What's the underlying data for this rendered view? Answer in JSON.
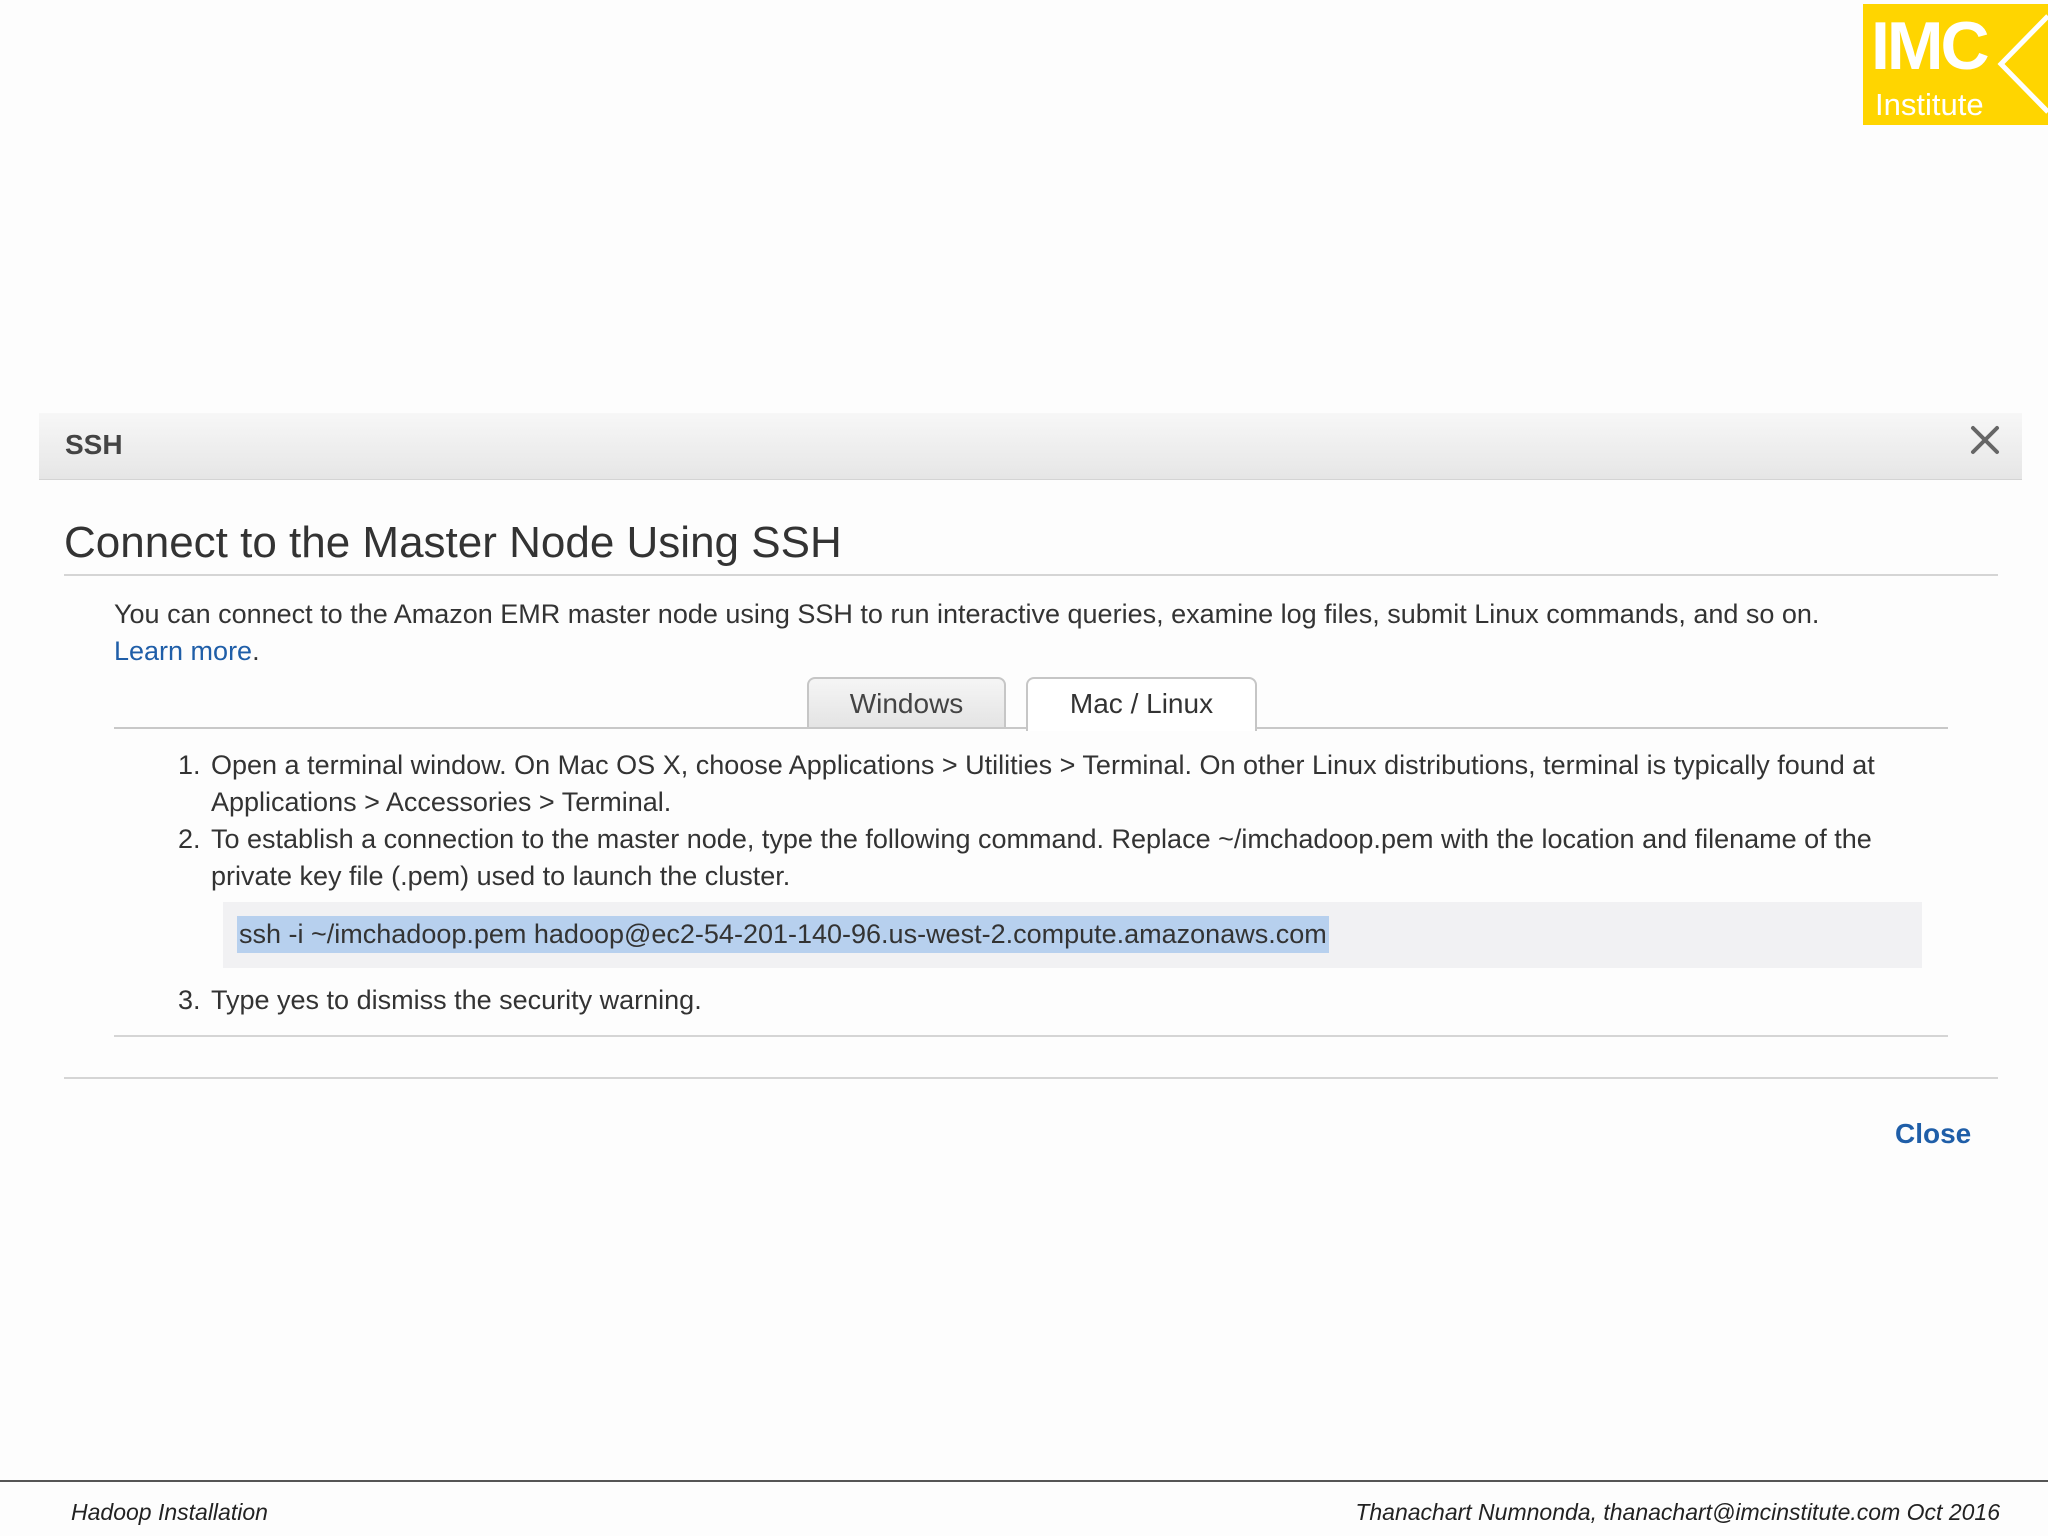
{
  "logo": {
    "word": "IMC",
    "sub": "Institute",
    "color": "#ffd500"
  },
  "dialog": {
    "header_title": "SSH",
    "close_icon": "close-x-icon",
    "heading": "Connect to the Master Node Using SSH",
    "intro": "You can connect to the Amazon EMR master node using SSH to run interactive queries, examine log files, submit Linux commands, and so on.",
    "learn_more": "Learn more",
    "learn_more_suffix": ".",
    "tabs": [
      {
        "label": "Windows",
        "active": false
      },
      {
        "label": "Mac / Linux",
        "active": true
      }
    ],
    "steps": [
      {
        "num": "1.",
        "text": "Open a terminal window. On Mac OS X, choose Applications > Utilities > Terminal. On other Linux distributions, terminal is typically found at Applications > Accessories > Terminal."
      },
      {
        "num": "2.",
        "text": "To establish a connection to the master node, type the following command. Replace ~/imchadoop.pem with the location and filename of the private key file (.pem) used to launch the cluster."
      },
      {
        "num": "3.",
        "text": "Type yes to dismiss the security warning."
      }
    ],
    "command": "ssh -i ~/imchadoop.pem hadoop@ec2-54-201-140-96.us-west-2.compute.amazonaws.com",
    "close_button": "Close",
    "link_color": "#1f5ea8",
    "selection_color": "#b7d0ee"
  },
  "slide_footer": {
    "left": "Hadoop Installation",
    "right": "Thanachart Numnonda,  thanachart@imcinstitute.com  Oct 2016"
  }
}
